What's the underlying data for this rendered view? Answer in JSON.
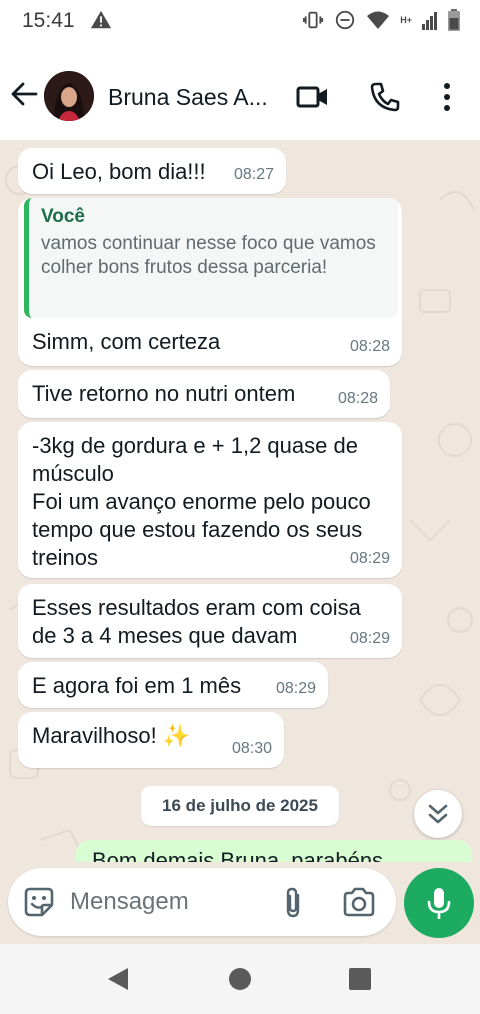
{
  "status_bar": {
    "time": "15:41",
    "network_label": "H+"
  },
  "header": {
    "contact_name": "Bruna Saes A..."
  },
  "messages": [
    {
      "text": "Oi Leo, bom dia!!!",
      "time": "08:27"
    },
    {
      "text": "Simm, com certeza",
      "time": "08:28",
      "quote": {
        "author": "Você",
        "text": "vamos continuar nesse foco que vamos colher bons frutos dessa parceria!"
      }
    },
    {
      "text": "Tive retorno no nutri ontem",
      "time": "08:28"
    },
    {
      "text": "-3kg de gordura e + 1,2 quase de músculo\nFoi um avanço enorme pelo pouco tempo que estou fazendo os seus treinos",
      "time": "08:29"
    },
    {
      "text": "Esses resultados eram com coisa de 3 a 4 meses que davam",
      "time": "08:29"
    },
    {
      "text": "E agora foi em 1 mês",
      "time": "08:29"
    },
    {
      "text": "Maravilhoso! ✨",
      "time": "08:30"
    }
  ],
  "date_separator": "16 de julho de 2025",
  "sent_preview": "Bom demais Bruna, parabéns",
  "composer": {
    "placeholder": "Mensagem"
  },
  "colors": {
    "chat_background": "#efe7de",
    "incoming_bubble": "#ffffff",
    "outgoing_bubble": "#d9fdd3",
    "accent_green": "#1daa61",
    "quote_bar": "#2db65f"
  },
  "icons": [
    "back-arrow-icon",
    "video-call-icon",
    "phone-icon",
    "more-options-icon",
    "emoji-icon",
    "paperclip-icon",
    "camera-icon",
    "microphone-icon",
    "chevron-double-down-icon"
  ]
}
